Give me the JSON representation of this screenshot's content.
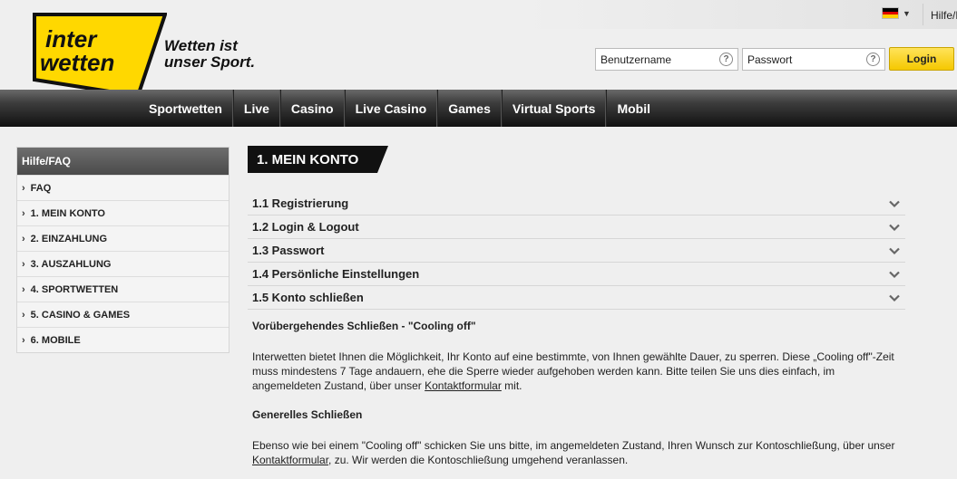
{
  "top": {
    "help_label": "Hilfe/FAQ",
    "language": "de"
  },
  "brand": {
    "logo_line1": "inter",
    "logo_line2": "wetten",
    "slogan_line1": "Wetten ist",
    "slogan_line2": "unser Sport."
  },
  "login": {
    "username_placeholder": "Benutzername",
    "password_placeholder": "Passwort",
    "help_mark": "?",
    "login_label": "Login"
  },
  "nav": {
    "items": [
      "Sportwetten",
      "Live",
      "Casino",
      "Live Casino",
      "Games",
      "Virtual Sports",
      "Mobil"
    ]
  },
  "sidebar": {
    "title": "Hilfe/FAQ",
    "items": [
      "FAQ",
      "1. MEIN KONTO",
      "2. EINZAHLUNG",
      "3. AUSZAHLUNG",
      "4. SPORTWETTEN",
      "5. CASINO & GAMES",
      "6. MOBILE"
    ]
  },
  "main": {
    "section_title": "1. MEIN KONTO",
    "accordion": [
      "1.1 Registrierung",
      "1.2 Login & Logout",
      "1.3 Passwort",
      "1.4 Persönliche Einstellungen",
      "1.5 Konto schließen"
    ],
    "cooling_heading": "Vorübergehendes Schließen - \"Cooling off\"",
    "cooling_text_before": "Interwetten bietet Ihnen die Möglichkeit, Ihr Konto auf eine bestimmte, von Ihnen gewählte Dauer, zu sperren. Diese „Cooling off\"-Zeit muss mindestens 7 Tage andauern, ehe die Sperre wieder aufgehoben werden kann. Bitte teilen Sie uns dies einfach, im angemeldeten Zustand, über unser ",
    "cooling_link": "Kontaktformular",
    "cooling_text_after": " mit.",
    "general_heading": "Generelles Schließen",
    "general_text_before": "Ebenso wie bei einem \"Cooling off\" schicken Sie uns bitte, im angemeldeten Zustand, Ihren Wunsch zur Kontoschließung, über unser ",
    "general_link": "Kontaktformular",
    "general_text_after": ", zu. Wir werden die Kontoschließung umgehend veranlassen."
  },
  "colors": {
    "brand_yellow": "#ffd800",
    "nav_dark": "#111111",
    "accent_button": "#f5c800"
  }
}
